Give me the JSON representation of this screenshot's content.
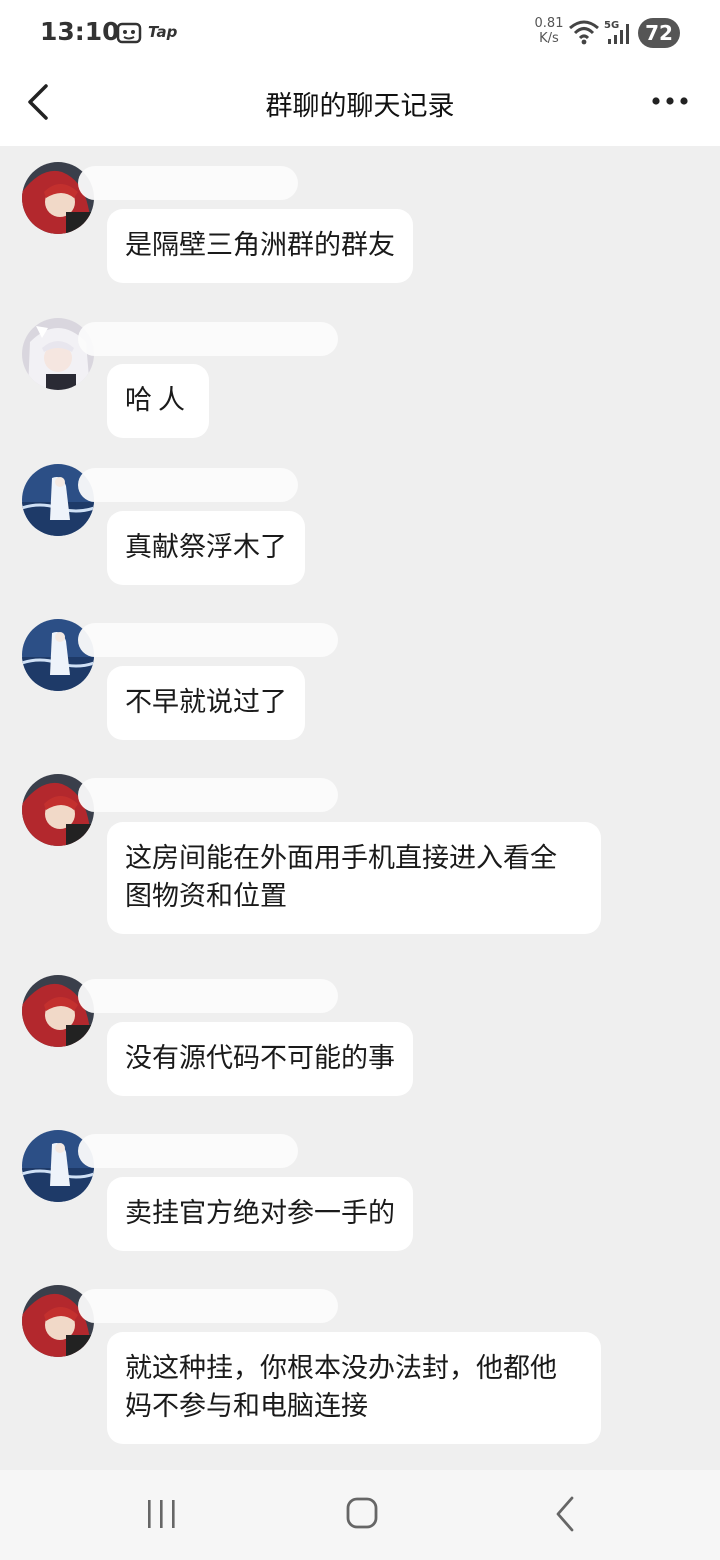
{
  "status_bar": {
    "time": "13:10",
    "app_label": "Tap",
    "net_speed_value": "0.81",
    "net_speed_unit": "K/s",
    "network_type": "5G",
    "battery": "72"
  },
  "header": {
    "title": "群聊的聊天记录",
    "back_icon": "chevron-left-icon",
    "more_icon": "more-dots-icon"
  },
  "messages": [
    {
      "avatar": "red-hair-avatar",
      "text": "是隔壁三角洲群的群友"
    },
    {
      "avatar": "white-hair-avatar",
      "text": "哈人"
    },
    {
      "avatar": "ocean-girl-avatar",
      "text": "真献祭浮木了"
    },
    {
      "avatar": "ocean-girl-avatar",
      "text": "不早就说过了"
    },
    {
      "avatar": "red-hair-avatar",
      "text": "这房间能在外面用手机直接进入看全图物资和位置"
    },
    {
      "avatar": "red-hair-avatar",
      "text": "没有源代码不可能的事"
    },
    {
      "avatar": "ocean-girl-avatar",
      "text": "卖挂官方绝对参一手的"
    },
    {
      "avatar": "red-hair-avatar",
      "text": "就这种挂，你根本没办法封，他都他妈不参与和电脑连接"
    }
  ],
  "nav_bar": {
    "recents_icon": "recents-icon",
    "home_icon": "home-icon",
    "back_icon": "back-arrow-icon"
  }
}
